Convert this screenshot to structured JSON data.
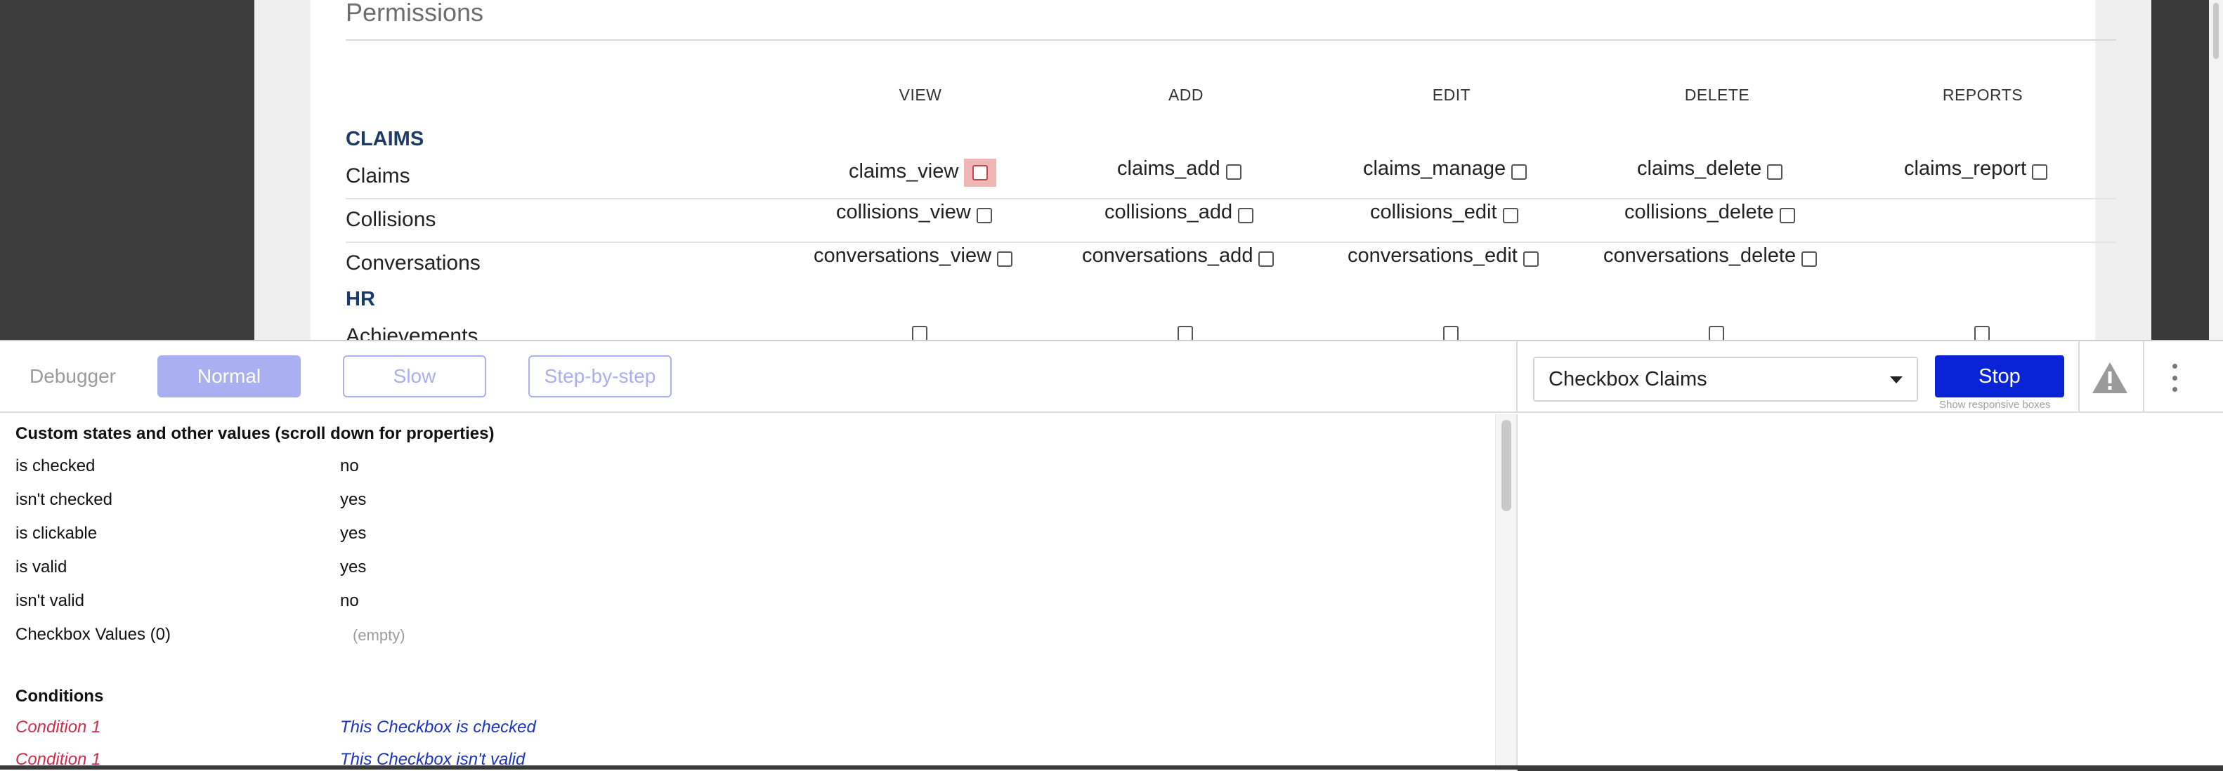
{
  "permissions": {
    "title": "Permissions",
    "columns": [
      "VIEW",
      "ADD",
      "EDIT",
      "DELETE",
      "REPORTS"
    ],
    "sections": [
      {
        "label": "CLAIMS",
        "rows": [
          {
            "label": "Claims",
            "cells": [
              "claims_view",
              "claims_add",
              "claims_manage",
              "claims_delete",
              "claims_report"
            ]
          },
          {
            "label": "Collisions",
            "cells": [
              "collisions_view",
              "collisions_add",
              "collisions_edit",
              "collisions_delete"
            ]
          },
          {
            "label": "Conversations",
            "cells": [
              "conversations_view",
              "conversations_add",
              "conversations_edit",
              "conversations_delete"
            ]
          }
        ]
      },
      {
        "label": "HR",
        "rows": [
          {
            "label": "Achievements",
            "cells": [
              "",
              "",
              "",
              "",
              ""
            ]
          }
        ]
      }
    ],
    "highlighted_cell": "claims_view"
  },
  "debugger": {
    "label": "Debugger",
    "speed_buttons": {
      "normal": "Normal",
      "slow": "Slow",
      "step": "Step-by-step"
    },
    "selected_speed": "Normal",
    "element_select": {
      "value": "Checkbox Claims"
    },
    "stop_label": "Stop",
    "responsive_hint": "Show responsive boxes",
    "icons": [
      "warning-icon",
      "more-vertical-icon"
    ]
  },
  "properties": {
    "heading": "Custom states and other values (scroll down for properties)",
    "items": [
      {
        "key": "is checked",
        "value": "no"
      },
      {
        "key": "isn't checked",
        "value": "yes"
      },
      {
        "key": "is clickable",
        "value": "yes"
      },
      {
        "key": "is valid",
        "value": "yes"
      },
      {
        "key": "isn't valid",
        "value": "no"
      },
      {
        "key": "Checkbox Values (0)",
        "value": ""
      }
    ],
    "empty_note": "(empty)",
    "conditions_heading": "Conditions",
    "conditions": [
      {
        "key": "Condition 1",
        "value": "This Checkbox is checked"
      },
      {
        "key": "Condition 1",
        "value": "This Checkbox isn't valid"
      }
    ]
  },
  "colors": {
    "section_label": "#1e3a66",
    "normal_button": "#a9aff0",
    "stop_button": "#0b23d6",
    "condition_key": "#d42a4a",
    "condition_value": "#1b33c4",
    "highlight": "#f0b5b5"
  }
}
